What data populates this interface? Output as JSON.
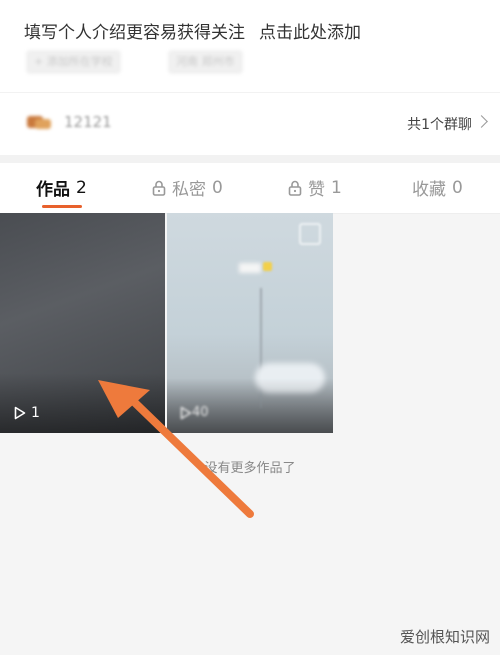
{
  "profile": {
    "intro_text_a": "填写个人介绍更容易获得关注",
    "intro_text_b": "点击此处添加",
    "tags": [
      "+ 添加所在学校",
      "河南 郑州市"
    ],
    "group_name": "12121",
    "group_count": "共1个群聊"
  },
  "tabs": [
    {
      "label": "作品",
      "count": "2",
      "locked": false
    },
    {
      "label": "私密",
      "count": "0",
      "locked": true
    },
    {
      "label": "赞",
      "count": "1",
      "locked": true
    },
    {
      "label": "收藏",
      "count": "0",
      "locked": false
    }
  ],
  "videos": [
    {
      "play_count": "1"
    },
    {
      "play_count": "40"
    }
  ],
  "footer_text": "没有更多作品了",
  "watermark": "爱创根知识网",
  "colors": {
    "accent": "#e8612c",
    "tab_underline": "#e8612c"
  },
  "icons": [
    "lock-icon",
    "play-icon",
    "chevron-right-icon",
    "arrow-annotation"
  ]
}
